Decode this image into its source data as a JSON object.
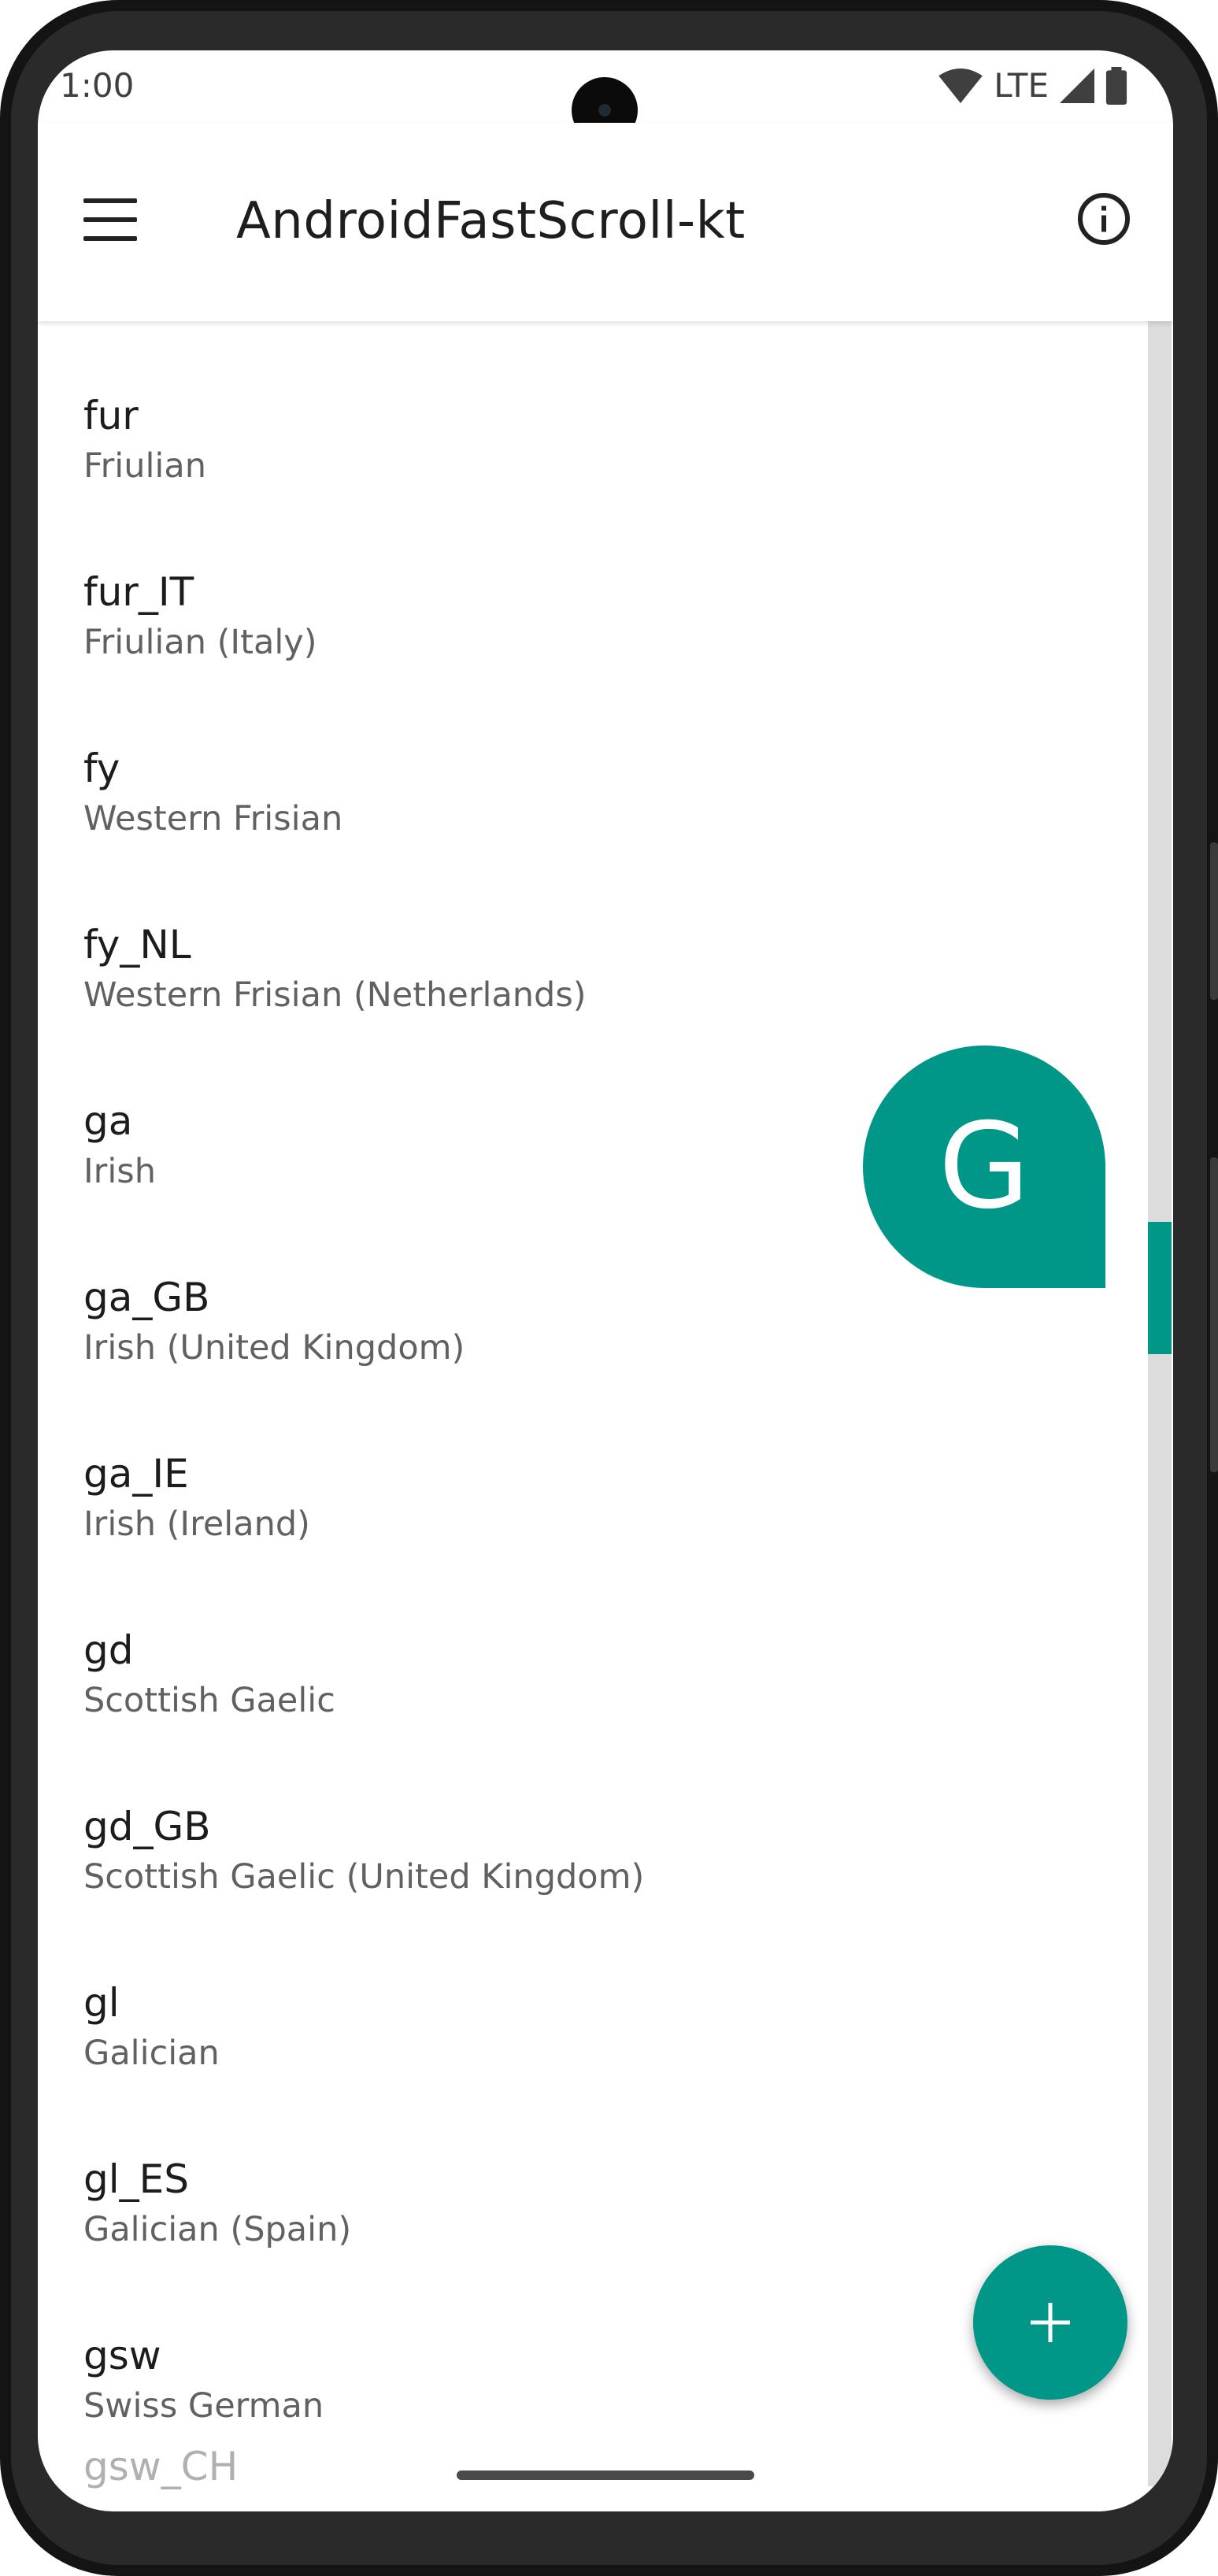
{
  "status_bar": {
    "time": "1:00",
    "network": "LTE"
  },
  "app_bar": {
    "title": "AndroidFastScroll-kt",
    "menu_icon": "menu-icon",
    "info_icon": "info-icon"
  },
  "items": [
    {
      "code": "fur",
      "name": "Friulian"
    },
    {
      "code": "fur_IT",
      "name": "Friulian (Italy)"
    },
    {
      "code": "fy",
      "name": "Western Frisian"
    },
    {
      "code": "fy_NL",
      "name": "Western Frisian (Netherlands)"
    },
    {
      "code": "ga",
      "name": "Irish"
    },
    {
      "code": "ga_GB",
      "name": "Irish (United Kingdom)"
    },
    {
      "code": "ga_IE",
      "name": "Irish (Ireland)"
    },
    {
      "code": "gd",
      "name": "Scottish Gaelic"
    },
    {
      "code": "gd_GB",
      "name": "Scottish Gaelic (United Kingdom)"
    },
    {
      "code": "gl",
      "name": "Galician"
    },
    {
      "code": "gl_ES",
      "name": "Galician (Spain)"
    },
    {
      "code": "gsw",
      "name": "Swiss German"
    }
  ],
  "partial_item": {
    "code": "gsw_CH"
  },
  "fast_scroll": {
    "popup_letter": "G",
    "accent": "#009688"
  },
  "fab": {
    "icon": "plus-icon"
  }
}
